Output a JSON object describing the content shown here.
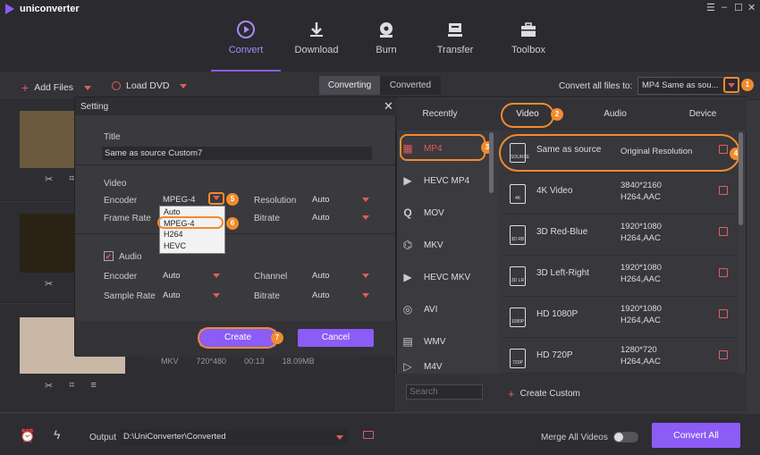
{
  "app": {
    "title": "uniconverter"
  },
  "nav": [
    {
      "label": "Convert",
      "icon": "convert-icon",
      "active": true
    },
    {
      "label": "Download",
      "icon": "download-icon"
    },
    {
      "label": "Burn",
      "icon": "burn-icon"
    },
    {
      "label": "Transfer",
      "icon": "transfer-icon"
    },
    {
      "label": "Toolbox",
      "icon": "toolbox-icon"
    }
  ],
  "toolbar": {
    "add_files": "Add Files",
    "load_dvd": "Load DVD",
    "tab_converting": "Converting",
    "tab_converted": "Converted",
    "convert_all_label": "Convert all files to:",
    "convert_all_value": "MP4 Same as sou..."
  },
  "file_row3": {
    "format": "MKV",
    "resolution": "720*480",
    "duration": "00:13",
    "size": "18.09MB"
  },
  "dialog": {
    "title": "Setting",
    "title_label": "Title",
    "title_value": "Same as source Custom7",
    "video_label": "Video",
    "encoder_label": "Encoder",
    "encoder_value": "MPEG-4",
    "resolution_label": "Resolution",
    "resolution_value": "Auto",
    "frame_rate_label": "Frame Rate",
    "frame_rate_value": "Auto",
    "bitrate_label": "Bitrate",
    "bitrate_value": "Auto",
    "encoder_options": [
      "Auto",
      "MPEG-4",
      "H264",
      "HEVC"
    ],
    "audio_label": "Audio",
    "a_encoder_label": "Encoder",
    "a_encoder_value": "Auto",
    "channel_label": "Channel",
    "channel_value": "Auto",
    "sample_rate_label": "Sample Rate",
    "sample_rate_value": "Auto",
    "a_bitrate_label": "Bitrate",
    "a_bitrate_value": "Auto",
    "create": "Create",
    "cancel": "Cancel"
  },
  "badges": [
    "1",
    "2",
    "3",
    "4",
    "5",
    "6",
    "7"
  ],
  "format_panel": {
    "tabs": [
      "Recently",
      "Video",
      "Audio",
      "Device"
    ],
    "formats": [
      "MP4",
      "HEVC MP4",
      "MOV",
      "MKV",
      "HEVC MKV",
      "AVI",
      "WMV",
      "M4V"
    ],
    "presets": [
      {
        "name": "Same as source",
        "res1": "Original Resolution",
        "res2": "",
        "tag": "SOURCE"
      },
      {
        "name": "4K Video",
        "res1": "3840*2160",
        "res2": "H264,AAC",
        "tag": "4K"
      },
      {
        "name": "3D Red-Blue",
        "res1": "1920*1080",
        "res2": "H264,AAC",
        "tag": "3D RB"
      },
      {
        "name": "3D Left-Right",
        "res1": "1920*1080",
        "res2": "H264,AAC",
        "tag": "3D LR"
      },
      {
        "name": "HD 1080P",
        "res1": "1920*1080",
        "res2": "H264,AAC",
        "tag": "1080P"
      },
      {
        "name": "HD 720P",
        "res1": "1280*720",
        "res2": "H264,AAC",
        "tag": "720P"
      }
    ],
    "search_placeholder": "Search",
    "create_custom": "Create Custom"
  },
  "bottom": {
    "output_label": "Output",
    "output_path": "D:\\UniConverter\\Converted",
    "merge_label": "Merge All Videos",
    "convert_all": "Convert All"
  },
  "colors": {
    "accent": "#8b5cf6",
    "highlight": "#f08c2b",
    "edit": "#e0605c"
  }
}
